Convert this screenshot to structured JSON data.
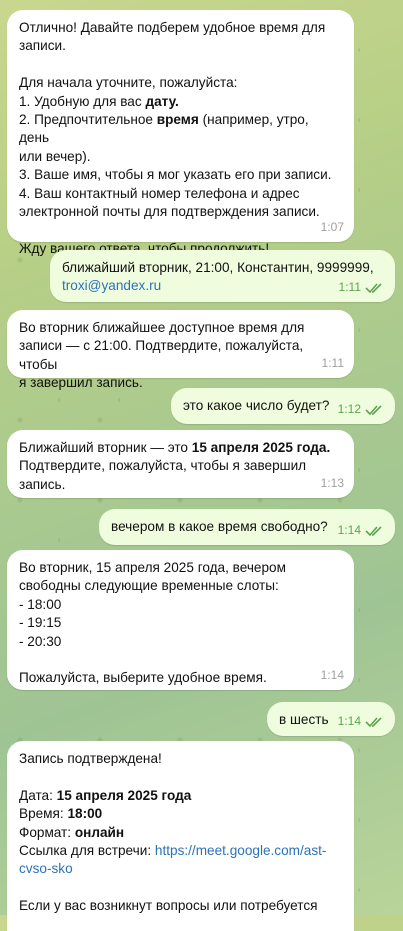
{
  "colors": {
    "incoming": "#ffffff",
    "outgoing": "#effdde",
    "link": "#2a73b8",
    "outgoing_time": "#5ba54f"
  },
  "messages": [
    {
      "direction": "in",
      "time": "1:07",
      "lines": [
        "Отлично! Давайте подберем удобное время для",
        "записи.",
        "",
        "Для начала уточните, пожалуйста:",
        "1. Удобную для вас ",
        "2. Предпочтительное ",
        "или вечер).",
        "3. Ваше имя, чтобы я мог указать его при записи.",
        "4. Ваш контактный номер телефона и адрес",
        "электронной почты для подтверждения записи.",
        "",
        "Жду вашего ответа, чтобы продолжить!"
      ],
      "bold_date": "дату.",
      "bold_time": "время",
      "time_rest": " (например, утро, день"
    },
    {
      "direction": "out",
      "time": "1:11",
      "lines": [
        "ближайший вторник, 21:00, Константин, 9999999,"
      ],
      "link": "troxi@yandex.ru"
    },
    {
      "direction": "in",
      "time": "1:11",
      "lines": [
        "Во вторник ближайшее доступное время для",
        "записи — с 21:00. Подтвердите, пожалуйста, чтобы",
        "я завершил запись."
      ]
    },
    {
      "direction": "out",
      "time": "1:12",
      "lines": [
        "это какое число будет?"
      ]
    },
    {
      "direction": "in",
      "time": "1:13",
      "prefix": "Ближайший вторник — это ",
      "bold": "15 апреля 2025 года.",
      "lines": [
        "Подтвердите, пожалуйста, чтобы я завершил",
        "запись."
      ]
    },
    {
      "direction": "out",
      "time": "1:14",
      "lines": [
        "вечером в какое время свободно?"
      ]
    },
    {
      "direction": "in",
      "time": "1:14",
      "lines": [
        "Во вторник, 15 апреля 2025 года, вечером",
        "свободны следующие временные слоты:",
        "- 18:00",
        "- 19:15",
        "- 20:30",
        "",
        "Пожалуйста, выберите удобное время."
      ]
    },
    {
      "direction": "out",
      "time": "1:14",
      "lines": [
        "в шесть"
      ]
    },
    {
      "direction": "in",
      "lines": [
        "Запись подтверждена!",
        ""
      ],
      "date_label": "Дата: ",
      "date_value": "15 апреля 2025 года",
      "time_label": "Время: ",
      "time_value": "18:00",
      "format_label": "Формат: ",
      "format_value": "онлайн",
      "link_label": "Ссылка для встречи: ",
      "link_part1": "https://meet.google.com/ast-",
      "link_part2": "cvso-sko",
      "tail": "Если у вас возникнут вопросы или потребуется"
    }
  ]
}
